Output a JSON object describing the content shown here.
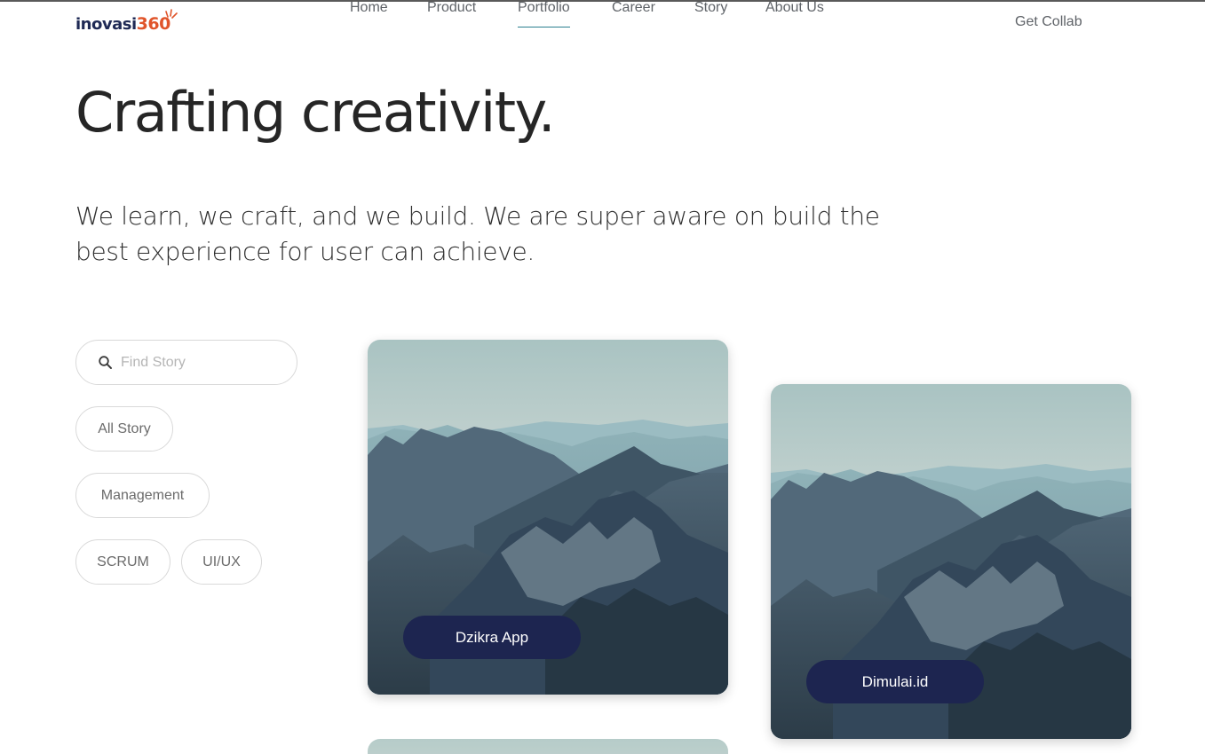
{
  "header": {
    "logo": {
      "word": "inovasi",
      "number": "360"
    },
    "nav": [
      {
        "label": "Home",
        "active": false
      },
      {
        "label": "Product",
        "active": false
      },
      {
        "label": "Portfolio",
        "active": true
      },
      {
        "label": "Career",
        "active": false
      },
      {
        "label": "Story",
        "active": false
      },
      {
        "label": "About Us",
        "active": false
      }
    ],
    "cta": "Get Collab"
  },
  "hero": {
    "title": "Crafting creativity.",
    "subtitle": "We learn, we craft, and we build. We are super aware on build the best experience for user can achieve."
  },
  "filters": {
    "search": {
      "placeholder": "Find Story",
      "value": "",
      "icon": "search-icon"
    },
    "chips": [
      "All Story",
      "Management",
      "SCRUM",
      "UI/UX"
    ]
  },
  "cards": [
    {
      "title": "Dzikra App"
    },
    {
      "title": "Dimulai.id"
    }
  ],
  "colors": {
    "accent": "#2a7f8f",
    "brand_navy": "#1d2550",
    "logo_orange": "#e0552b"
  }
}
